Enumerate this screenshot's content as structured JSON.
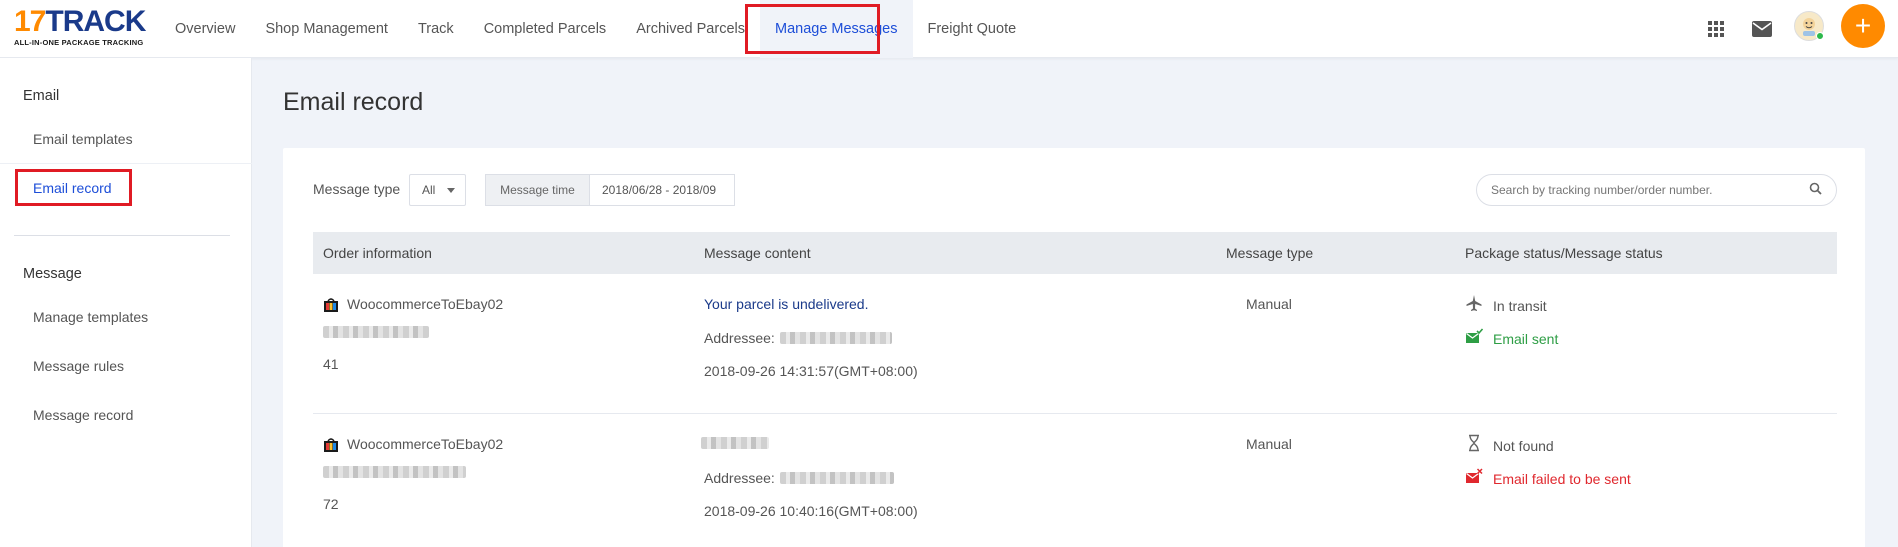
{
  "logo": {
    "main_prefix": "17",
    "main_suffix": "TRACK",
    "sub": "ALL-IN-ONE PACKAGE TRACKING"
  },
  "nav": {
    "items": [
      {
        "label": "Overview"
      },
      {
        "label": "Shop Management"
      },
      {
        "label": "Track"
      },
      {
        "label": "Completed Parcels"
      },
      {
        "label": "Archived Parcels"
      },
      {
        "label": "Manage Messages"
      },
      {
        "label": "Freight Quote"
      }
    ],
    "active": "Manage Messages",
    "plus_label": "+"
  },
  "sidebar": {
    "email_group": "Email",
    "email_items": [
      {
        "label": "Email templates"
      },
      {
        "label": "Email record"
      }
    ],
    "message_group": "Message",
    "message_items": [
      {
        "label": "Manage templates"
      },
      {
        "label": "Message rules"
      },
      {
        "label": "Message record"
      }
    ],
    "active": "Email record"
  },
  "page": {
    "title": "Email record"
  },
  "filters": {
    "message_type_label": "Message type",
    "message_type_value": "All",
    "message_time_label": "Message time",
    "message_time_value": "2018/06/28 - 2018/09",
    "search_placeholder": "Search by tracking number/order number."
  },
  "table": {
    "columns": [
      "Order information",
      "Message content",
      "Message type",
      "Package status/Message status"
    ],
    "rows": [
      {
        "shop": "WoocommerceToEbay02",
        "order_suffix": "41",
        "content_title": "Your parcel is undelivered.",
        "addressee_label": "Addressee:",
        "time": "2018-09-26 14:31:57(GMT+08:00)",
        "message_type": "Manual",
        "package_status": "In transit",
        "message_status": "Email sent"
      },
      {
        "shop": "WoocommerceToEbay02",
        "order_suffix": "72",
        "content_title": "",
        "addressee_label": "Addressee:",
        "time": "2018-09-26 10:40:16(GMT+08:00)",
        "message_type": "Manual",
        "package_status": "Not found",
        "message_status": "Email failed to be sent"
      }
    ]
  },
  "colors": {
    "accent": "#1d4ed8",
    "brand_orange": "#ff8a00",
    "highlight_box": "#e01b24",
    "success": "#2e9e45",
    "error": "#e0282e"
  }
}
